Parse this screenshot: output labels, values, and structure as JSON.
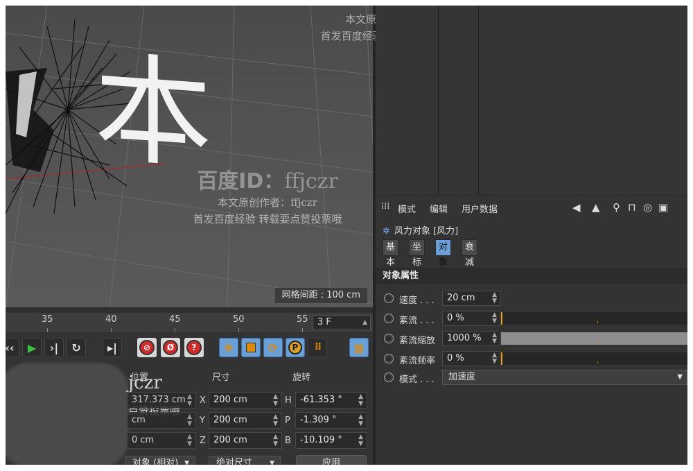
{
  "watermark": {
    "id_prefix": "百度ID：",
    "id_name": "ffjczr",
    "author_line": "本文原创作者：ffjczr",
    "promo_line": "首发百度经验 转载要点赞投票哦",
    "coord_overlay": "jczr",
    "coord_overlay_2": "转载要点赞投票哦",
    "coord_overlay_3": "点赞投票哦"
  },
  "viewport": {
    "big_text": "本",
    "grid_spacing": "网格间距 : 100 cm"
  },
  "timeline": {
    "ticks": [
      "35",
      "40",
      "45",
      "50",
      "55"
    ],
    "frame_value": "3 F"
  },
  "transport": {
    "icons": [
      "prev-key-icon",
      "play-icon",
      "next-key-icon",
      "loop-icon",
      "goto-end-icon",
      "record-icon",
      "autokey-icon",
      "keyframe-help-icon",
      "move-icon",
      "scale-icon",
      "rotate-icon",
      "param-icon",
      "points-icon",
      "film-icon"
    ],
    "autokey_glyph": "Ø",
    "help_glyph": "?",
    "param_glyph": "P"
  },
  "coords": {
    "headers": {
      "position": "位置",
      "size": "尺寸",
      "rotation": "旋转"
    },
    "position": {
      "x": "317.373 cm",
      "y": "cm",
      "z": "0 cm"
    },
    "size_axes": [
      "X",
      "Y",
      "Z"
    ],
    "size": [
      "200 cm",
      "200 cm",
      "200 cm"
    ],
    "rot_axes": [
      "H",
      "P",
      "B"
    ],
    "rotation": [
      "-61.353 °",
      "-1.309 °",
      "-10.109 °"
    ],
    "mode_dropdown": "对象 (相对)",
    "size_dropdown": "绝对尺寸",
    "apply": "应用"
  },
  "attributes": {
    "menu": [
      "模式",
      "编辑",
      "用户数据"
    ],
    "object_title": "风力对象 [风力]",
    "tabs": [
      "基本",
      "坐标",
      "对象",
      "衰减"
    ],
    "active_tab": "对象",
    "section": "对象属性",
    "props": [
      {
        "label": "速度 . . .",
        "value": "20 cm",
        "fill": null
      },
      {
        "label": "紊流 . . .",
        "value": "0 %",
        "fill": 0
      },
      {
        "label": "紊流缩放",
        "value": "1000 %",
        "fill": 1.0
      },
      {
        "label": "紊流频率",
        "value": "0 %",
        "fill": 0
      }
    ],
    "mode_label": "模式 . . .",
    "mode_value": "加速度"
  },
  "colors": {
    "accent_blue": "#6aa0d8",
    "record_red": "#d42a2a",
    "slider_orange": "#e6a000"
  }
}
